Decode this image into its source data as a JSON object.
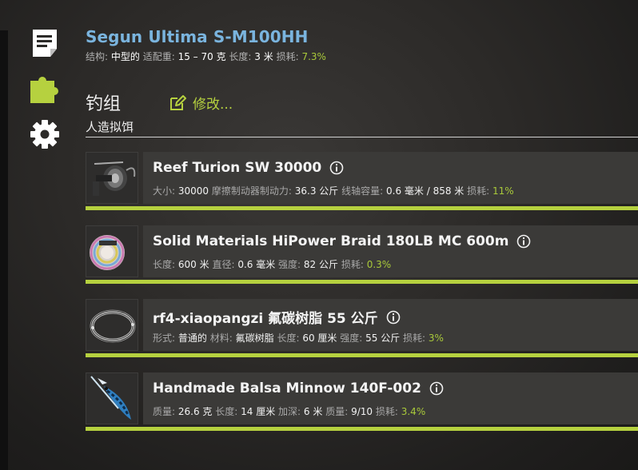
{
  "rod": {
    "name": "Segun Ultima S-M100HH",
    "stats": [
      {
        "label": "结构:",
        "value": "中型的"
      },
      {
        "label": "适配重:",
        "value": "15 – 70 克"
      },
      {
        "label": "长度:",
        "value": "3 米"
      },
      {
        "label": "损耗:",
        "value": "7.3%",
        "wear": true
      }
    ]
  },
  "sidebar": [
    {
      "icon": "document-icon"
    },
    {
      "icon": "puzzle-icon"
    },
    {
      "icon": "gear-icon"
    }
  ],
  "section": {
    "title": "钓组",
    "subtitle": "人造拟饵",
    "edit_label": "修改..."
  },
  "colors": {
    "accent": "#b6d13f",
    "rod_name": "#7ab4de",
    "wear": "#a9c93a"
  },
  "items": [
    {
      "name": "Reef Turion SW 30000",
      "icon": "spinning-reel",
      "stats": [
        {
          "label": "大小:",
          "value": "30000"
        },
        {
          "label": "摩擦制动器制动力:",
          "value": "36.3 公斤"
        },
        {
          "label": "线轴容量:",
          "value": "0.6 毫米 / 858 米"
        },
        {
          "label": "损耗:",
          "value": "11%",
          "wear": true
        }
      ]
    },
    {
      "name": "Solid Materials HiPower Braid 180LB MC 600m",
      "icon": "line-spool",
      "stats": [
        {
          "label": "长度:",
          "value": "600 米"
        },
        {
          "label": "直径:",
          "value": "0.6 毫米"
        },
        {
          "label": "强度:",
          "value": "82 公斤"
        },
        {
          "label": "损耗:",
          "value": "0.3%",
          "wear": true
        }
      ]
    },
    {
      "name": "rf4-xiaopangzi 氟碳树脂 55 公斤",
      "icon": "leader-coil",
      "stats": [
        {
          "label": "形式:",
          "value": "普通的"
        },
        {
          "label": "材料:",
          "value": "氟碳树脂"
        },
        {
          "label": "长度:",
          "value": "60 厘米"
        },
        {
          "label": "强度:",
          "value": "55 公斤"
        },
        {
          "label": "损耗:",
          "value": "3%",
          "wear": true
        }
      ]
    },
    {
      "name": "Handmade Balsa Minnow 140F-002",
      "icon": "minnow-lure",
      "stats": [
        {
          "label": "质量:",
          "value": "26.6 克"
        },
        {
          "label": "长度:",
          "value": "14 厘米"
        },
        {
          "label": "加深:",
          "value": "6 米"
        },
        {
          "label": "质量:",
          "value": "9/10"
        },
        {
          "label": "损耗:",
          "value": "3.4%",
          "wear": true
        }
      ]
    }
  ]
}
